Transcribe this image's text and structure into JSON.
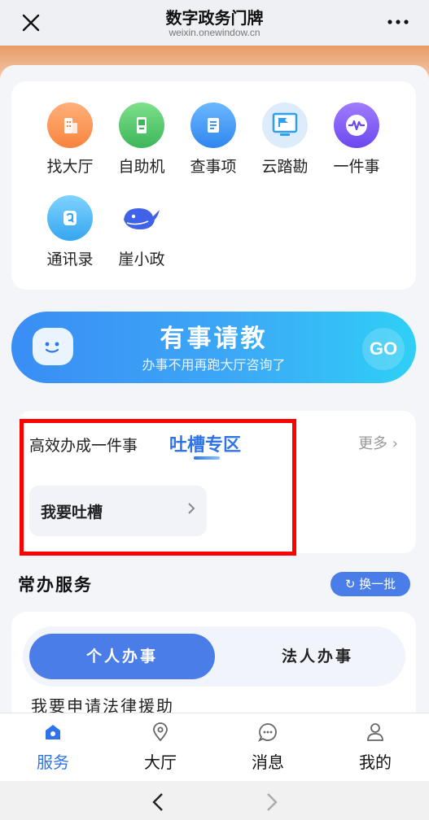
{
  "window": {
    "title": "数字政务门牌",
    "url": "weixin.onewindow.cn"
  },
  "grid": {
    "items": [
      {
        "label": "找大厅",
        "icon": "building-icon",
        "color": "#f8914a"
      },
      {
        "label": "自助机",
        "icon": "kiosk-icon",
        "color": "#4fc26a"
      },
      {
        "label": "查事项",
        "icon": "document-icon",
        "color": "#3f96f0"
      },
      {
        "label": "云踏勘",
        "icon": "monitor-icon",
        "color": "#2f9df0"
      },
      {
        "label": "一件事",
        "icon": "pulse-icon",
        "color": "#7b5af0"
      },
      {
        "label": "通讯录",
        "icon": "contacts-icon",
        "color": "#3fb3f2"
      },
      {
        "label": "崖小政",
        "icon": "whale-icon",
        "color": "#3f62e6"
      }
    ]
  },
  "ask_banner": {
    "title": "有事请教",
    "subtitle": "办事不用再跑大厅咨询了",
    "go_label": "GO"
  },
  "feedback": {
    "tab_efficiency": "高效办成一件事",
    "tab_feedback": "吐槽专区",
    "more_label": "更多",
    "button_label": "我要吐槽"
  },
  "common_services": {
    "title": "常办服务",
    "refresh_label": "换一批",
    "tab_personal": "个人办事",
    "tab_legal": "法人办事",
    "partial_text": "我要申请法律援助"
  },
  "tabbar": {
    "items": [
      {
        "label": "服务",
        "icon": "home-icon",
        "active": true
      },
      {
        "label": "大厅",
        "icon": "location-icon",
        "active": false
      },
      {
        "label": "消息",
        "icon": "message-icon",
        "active": false
      },
      {
        "label": "我的",
        "icon": "user-icon",
        "active": false
      }
    ]
  },
  "colors": {
    "accent": "#2e74e8",
    "primary_button": "#4a7de8",
    "highlight": "#ff0000"
  }
}
